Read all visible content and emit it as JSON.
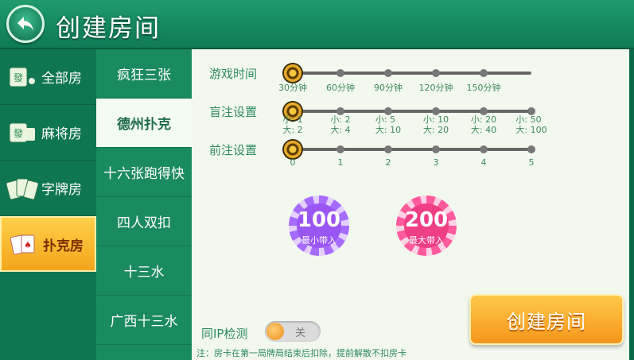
{
  "header": {
    "title": "创建房间"
  },
  "categories": [
    {
      "label": "全部房"
    },
    {
      "label": "麻将房"
    },
    {
      "label": "字牌房"
    },
    {
      "label": "扑克房"
    }
  ],
  "games": [
    {
      "label": "疯狂三张"
    },
    {
      "label": "德州扑克"
    },
    {
      "label": "十六张跑得快"
    },
    {
      "label": "四人双扣"
    },
    {
      "label": "十三水"
    },
    {
      "label": "广西十三水"
    }
  ],
  "settings": {
    "game_time": {
      "label": "游戏时间",
      "options": [
        "30分钟",
        "60分钟",
        "90分钟",
        "120分钟",
        "150分钟"
      ],
      "selected_index": 0
    },
    "blinds": {
      "label": "盲注设置",
      "options": [
        {
          "small": "小: 1",
          "big": "大: 2"
        },
        {
          "small": "小: 2",
          "big": "大: 4"
        },
        {
          "small": "小: 5",
          "big": "大: 10"
        },
        {
          "small": "小: 10",
          "big": "大: 20"
        },
        {
          "small": "小: 20",
          "big": "大: 40"
        },
        {
          "small": "小: 50",
          "big": "大: 100"
        }
      ],
      "selected_index": 0
    },
    "ante": {
      "label": "前注设置",
      "options": [
        "0",
        "1",
        "2",
        "3",
        "4",
        "5"
      ],
      "selected_index": 0
    }
  },
  "chips": {
    "min": {
      "value": "100",
      "label": "最小带入"
    },
    "max": {
      "value": "200",
      "label": "最大带入"
    }
  },
  "create_button": "创建房间",
  "ip_check": {
    "label": "同IP检测",
    "toggle": "关"
  },
  "note": "注：房卡在第一局牌局结束后扣除，提前解散不扣房卡",
  "colors": {
    "accent": "#f5a623",
    "primary": "#0e7650",
    "panel": "#f2f8ee"
  }
}
